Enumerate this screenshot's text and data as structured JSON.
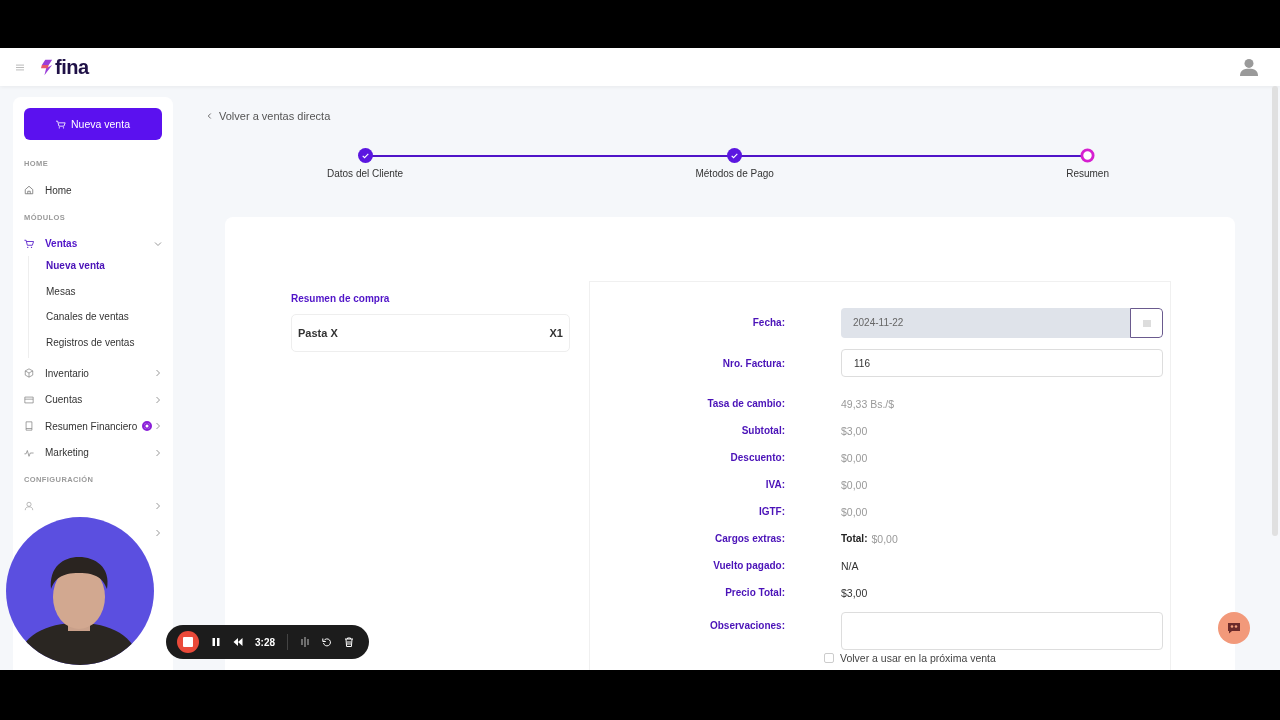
{
  "header": {
    "logo": "fina"
  },
  "sidebar": {
    "new_sale_button": "Nueva venta",
    "sections": [
      {
        "title": "HOME",
        "items": [
          {
            "label": "Home",
            "selected": false
          }
        ]
      },
      {
        "title": "MÓDULOS",
        "items": [
          {
            "label": "Ventas",
            "selected": true,
            "expanded": true,
            "children": [
              {
                "label": "Nueva venta",
                "selected": true
              },
              {
                "label": "Mesas",
                "selected": false
              },
              {
                "label": "Canales de ventas",
                "selected": false
              },
              {
                "label": "Registros de ventas",
                "selected": false
              }
            ]
          },
          {
            "label": "Inventario",
            "selected": false,
            "expanded": false
          },
          {
            "label": "Cuentas",
            "selected": false,
            "expanded": false
          },
          {
            "label": "Resumen Financiero",
            "selected": false,
            "expanded": false,
            "badge": true
          },
          {
            "label": "Marketing",
            "selected": false,
            "expanded": false
          }
        ]
      },
      {
        "title": "CONFIGURACIÓN"
      }
    ]
  },
  "back_link": "Volver a ventas directa",
  "steps": [
    {
      "label": "Datos del Cliente",
      "completed": true
    },
    {
      "label": "Métodos de Pago",
      "completed": true
    },
    {
      "label": "Resumen",
      "completed": false
    }
  ],
  "purchase_summary": {
    "title": "Resumen de compra",
    "items": [
      {
        "name": "Pasta X",
        "quantity": "X1"
      }
    ]
  },
  "details": [
    {
      "kind": "date",
      "label": "Fecha:",
      "value": "2024-11-22"
    },
    {
      "kind": "input",
      "label": "Nro. Factura:",
      "value": "116"
    },
    {
      "kind": "muted",
      "label": "Tasa de cambio:",
      "value": "49,33 Bs./$"
    },
    {
      "kind": "muted",
      "label": "Subtotal:",
      "value": "$3,00"
    },
    {
      "kind": "muted",
      "label": "Descuento:",
      "value": "$0,00"
    },
    {
      "kind": "muted",
      "label": "IVA:",
      "value": "$0,00"
    },
    {
      "kind": "muted",
      "label": "IGTF:",
      "value": "$0,00"
    },
    {
      "kind": "labeled",
      "label": "Cargos extras:",
      "prefix": "Total:",
      "value": "$0,00"
    },
    {
      "kind": "strong",
      "label": "Vuelto pagado:",
      "value": "N/A"
    },
    {
      "kind": "strong",
      "label": "Precio Total:",
      "value": "$3,00"
    },
    {
      "kind": "textarea",
      "label": "Observaciones:"
    }
  ],
  "reuse_checkbox": {
    "label": "Volver a usar en la próxima venta",
    "checked": false
  },
  "recorder": {
    "time": "3:28"
  }
}
